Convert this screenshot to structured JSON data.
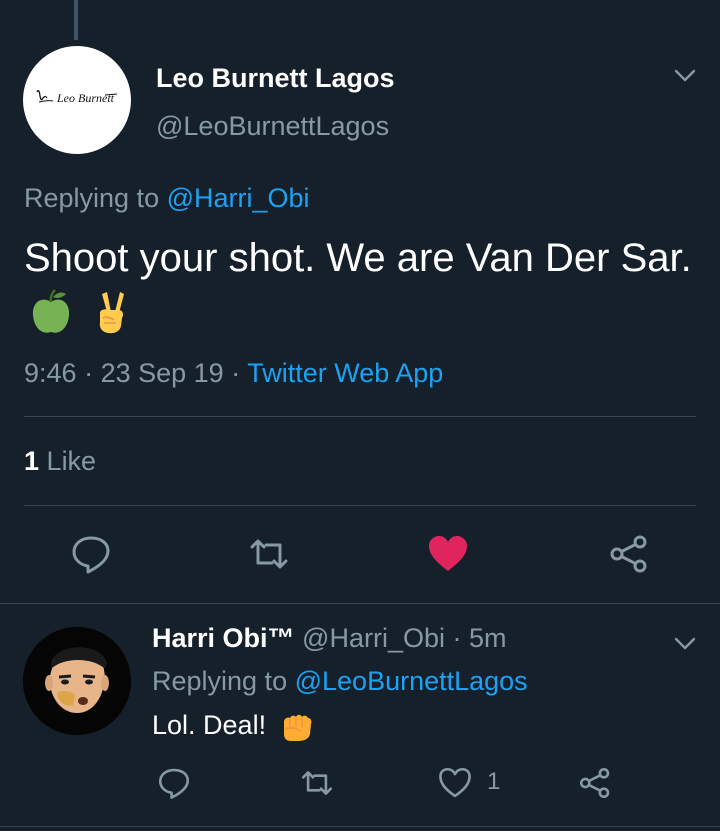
{
  "main_tweet": {
    "author_name": "Leo Burnett Lagos",
    "author_handle": "@LeoBurnettLagos",
    "avatar_signature": "Leo Burnett",
    "replying_prefix": "Replying to",
    "replying_to": "@Harri_Obi",
    "text": "Shoot your shot. We are Van Der Sar.",
    "emojis": [
      "green-apple-icon",
      "victory-hand-icon"
    ],
    "time": "9:46",
    "date": "23 Sep 19",
    "separator": "·",
    "source": "Twitter Web App",
    "like_count": "1",
    "like_label": "Like"
  },
  "reply_tweet": {
    "author_name": "Harri Obi™",
    "author_handle": "@Harri_Obi",
    "age": "5m",
    "separator": "·",
    "replying_prefix": "Replying to",
    "replying_to": "@LeoBurnettLagos",
    "text": "Lol. Deal!",
    "emoji": "fist-icon",
    "like_count": "1"
  },
  "colors": {
    "background": "#15202b",
    "secondary_text": "#8899a6",
    "link": "#1da1f2",
    "liked": "#e0245e",
    "divider": "#38444d"
  }
}
